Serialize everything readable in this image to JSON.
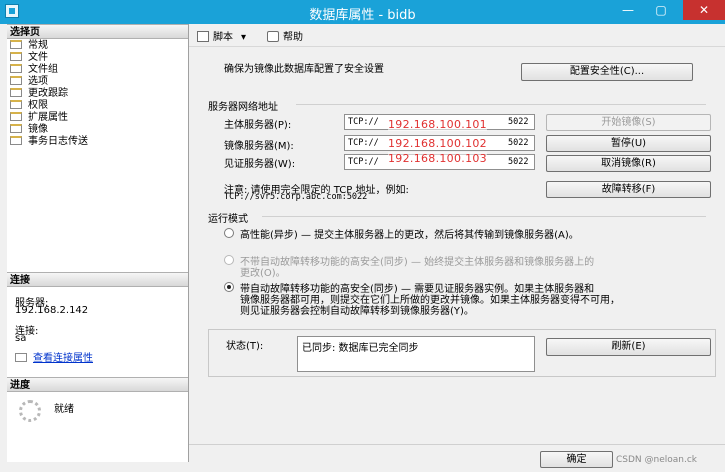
{
  "window": {
    "title": "数据库属性 - bidb",
    "controls": [
      "—",
      "▢",
      "✕"
    ]
  },
  "left": {
    "select_page_header": "选择页",
    "pages": [
      "常规",
      "文件",
      "文件组",
      "选项",
      "更改跟踪",
      "权限",
      "扩展属性",
      "镜像",
      "事务日志传送"
    ],
    "connection_header": "连接",
    "server_label": "服务器:",
    "server_value": "192.168.2.142",
    "connection_label": "连接:",
    "connection_value": "sa",
    "view_connection_link": "查看连接属性",
    "progress_header": "进度",
    "progress_status": "就绪"
  },
  "toolbar": {
    "script_label": "脚本",
    "help_label": "帮助"
  },
  "main": {
    "security_note": "确保为镜像此数据库配置了安全设置",
    "configure_security_button": "配置安全性(C)...",
    "server_addresses_header": "服务器网络地址",
    "principal_label": "主体服务器(P):",
    "principal_prefix": "TCP://",
    "principal_ip": "192.168.100.101",
    "principal_suffix": "5022",
    "mirror_label": "镜像服务器(M):",
    "mirror_prefix": "TCP://",
    "mirror_ip": "192.168.100.102",
    "mirror_suffix": "5022",
    "witness_label": "见证服务器(W):",
    "witness_prefix": "TCP://",
    "witness_ip": "192.168.100.103",
    "witness_suffix": "5022",
    "start_mirroring_button": "开始镜像(S)",
    "pause_button": "暂停(U)",
    "remove_mirroring_button": "取消镜像(R)",
    "failover_button": "故障转移(F)",
    "note_line1": "注意: 请使用完全限定的 TCP 地址，例如:",
    "note_line2": "TCP://svr5.corp.abc.com:5022",
    "operating_mode_header": "运行模式",
    "mode_high_performance": "高性能(异步) — 提交主体服务器上的更改，然后将其传输到镜像服务器(A)。",
    "mode_high_safety_no_failover_line1": "不带自动故障转移功能的高安全(同步) — 始终提交主体服务器和镜像服务器上的",
    "mode_high_safety_no_failover_line2": "更改(O)。",
    "mode_high_safety_failover_line1": "带自动故障转移功能的高安全(同步) — 需要见证服务器实例。如果主体服务器和",
    "mode_high_safety_failover_line2": "镜像服务器都可用，则提交在它们上所做的更改并镜像。如果主体服务器变得不可用，",
    "mode_high_safety_failover_line3": "则见证服务器会控制自动故障转移到镜像服务器(Y)。",
    "status_label": "状态(T):",
    "status_value": "已同步: 数据库已完全同步",
    "refresh_button": "刷新(E)",
    "ok_button": "确定",
    "watermark": "CSDN @neloan.ck"
  }
}
